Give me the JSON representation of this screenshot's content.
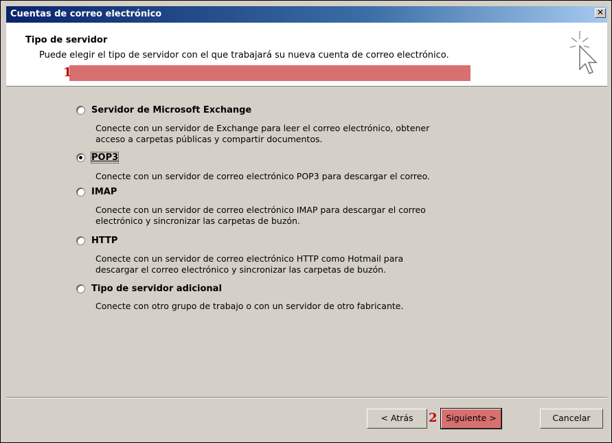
{
  "window": {
    "title": "Cuentas de correo electrónico",
    "close_glyph": "✕"
  },
  "header": {
    "title": "Tipo de servidor",
    "description": "Puede elegir el tipo de servidor con el que trabajará su nueva cuenta de correo electrónico.",
    "icon": "wizard-cursor-icon"
  },
  "options": [
    {
      "label": "Servidor de Microsoft Exchange",
      "selected": false,
      "desc1": "Conecte con un servidor de Exchange para leer el correo electrónico, obtener",
      "desc2": "acceso a carpetas públicas y compartir documentos."
    },
    {
      "label": "POP3",
      "selected": true,
      "desc1": "Conecte con un servidor de correo electrónico POP3 para descargar el correo.",
      "desc2": ""
    },
    {
      "label": "IMAP",
      "selected": false,
      "desc1": "Conecte con un servidor de correo electrónico IMAP para descargar el correo",
      "desc2": "electrónico y sincronizar las carpetas de buzón."
    },
    {
      "label": "HTTP",
      "selected": false,
      "desc1": "Conecte con un servidor de correo electrónico HTTP como Hotmail para",
      "desc2": "descargar el correo electrónico y sincronizar las carpetas de buzón."
    },
    {
      "label": "Tipo de servidor adicional",
      "selected": false,
      "desc1": "Conecte con otro grupo de trabajo o con un servidor de otro fabricante.",
      "desc2": ""
    }
  ],
  "markers": {
    "step1": "1",
    "step2": "2"
  },
  "buttons": {
    "back": "< Atrás",
    "next": "Siguiente >",
    "cancel": "Cancelar"
  },
  "colors": {
    "highlight": "#d97070",
    "marker": "#c00000",
    "title_bar": "#0a246a"
  }
}
